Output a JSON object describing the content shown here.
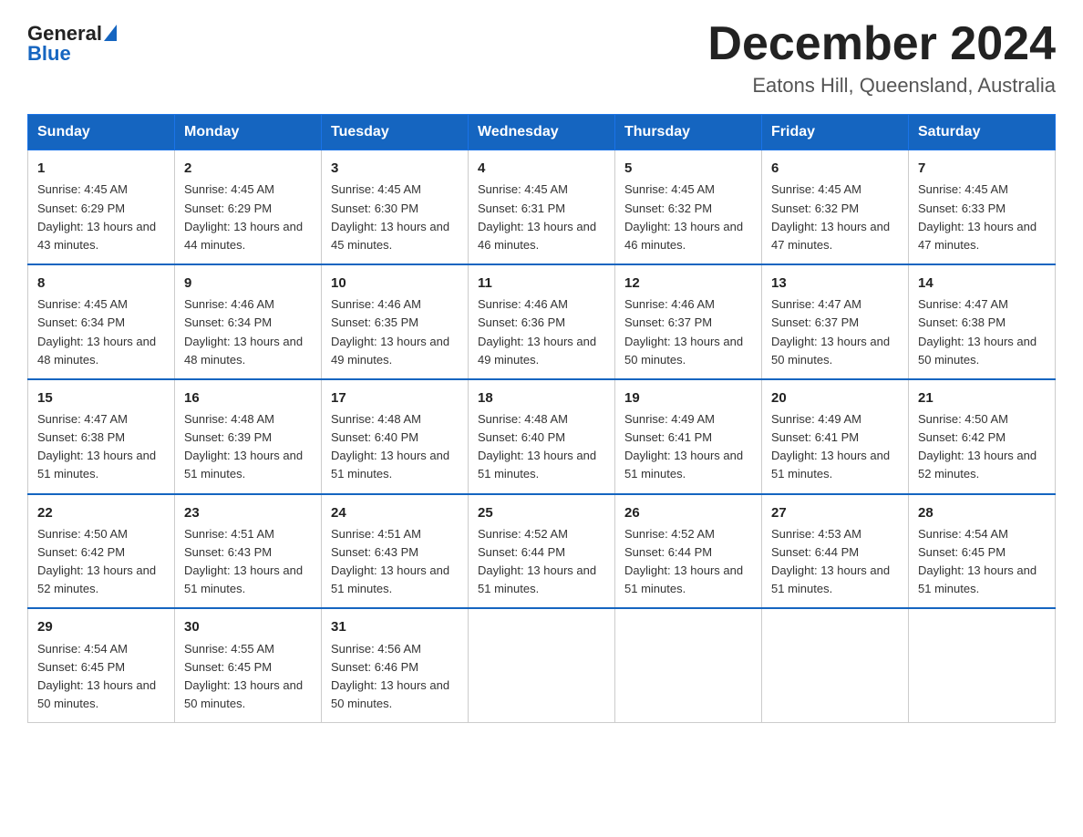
{
  "logo": {
    "general": "General",
    "blue": "Blue"
  },
  "header": {
    "title": "December 2024",
    "subtitle": "Eatons Hill, Queensland, Australia"
  },
  "weekdays": [
    "Sunday",
    "Monday",
    "Tuesday",
    "Wednesday",
    "Thursday",
    "Friday",
    "Saturday"
  ],
  "weeks": [
    [
      {
        "day": "1",
        "sunrise": "4:45 AM",
        "sunset": "6:29 PM",
        "daylight": "13 hours and 43 minutes."
      },
      {
        "day": "2",
        "sunrise": "4:45 AM",
        "sunset": "6:29 PM",
        "daylight": "13 hours and 44 minutes."
      },
      {
        "day": "3",
        "sunrise": "4:45 AM",
        "sunset": "6:30 PM",
        "daylight": "13 hours and 45 minutes."
      },
      {
        "day": "4",
        "sunrise": "4:45 AM",
        "sunset": "6:31 PM",
        "daylight": "13 hours and 46 minutes."
      },
      {
        "day": "5",
        "sunrise": "4:45 AM",
        "sunset": "6:32 PM",
        "daylight": "13 hours and 46 minutes."
      },
      {
        "day": "6",
        "sunrise": "4:45 AM",
        "sunset": "6:32 PM",
        "daylight": "13 hours and 47 minutes."
      },
      {
        "day": "7",
        "sunrise": "4:45 AM",
        "sunset": "6:33 PM",
        "daylight": "13 hours and 47 minutes."
      }
    ],
    [
      {
        "day": "8",
        "sunrise": "4:45 AM",
        "sunset": "6:34 PM",
        "daylight": "13 hours and 48 minutes."
      },
      {
        "day": "9",
        "sunrise": "4:46 AM",
        "sunset": "6:34 PM",
        "daylight": "13 hours and 48 minutes."
      },
      {
        "day": "10",
        "sunrise": "4:46 AM",
        "sunset": "6:35 PM",
        "daylight": "13 hours and 49 minutes."
      },
      {
        "day": "11",
        "sunrise": "4:46 AM",
        "sunset": "6:36 PM",
        "daylight": "13 hours and 49 minutes."
      },
      {
        "day": "12",
        "sunrise": "4:46 AM",
        "sunset": "6:37 PM",
        "daylight": "13 hours and 50 minutes."
      },
      {
        "day": "13",
        "sunrise": "4:47 AM",
        "sunset": "6:37 PM",
        "daylight": "13 hours and 50 minutes."
      },
      {
        "day": "14",
        "sunrise": "4:47 AM",
        "sunset": "6:38 PM",
        "daylight": "13 hours and 50 minutes."
      }
    ],
    [
      {
        "day": "15",
        "sunrise": "4:47 AM",
        "sunset": "6:38 PM",
        "daylight": "13 hours and 51 minutes."
      },
      {
        "day": "16",
        "sunrise": "4:48 AM",
        "sunset": "6:39 PM",
        "daylight": "13 hours and 51 minutes."
      },
      {
        "day": "17",
        "sunrise": "4:48 AM",
        "sunset": "6:40 PM",
        "daylight": "13 hours and 51 minutes."
      },
      {
        "day": "18",
        "sunrise": "4:48 AM",
        "sunset": "6:40 PM",
        "daylight": "13 hours and 51 minutes."
      },
      {
        "day": "19",
        "sunrise": "4:49 AM",
        "sunset": "6:41 PM",
        "daylight": "13 hours and 51 minutes."
      },
      {
        "day": "20",
        "sunrise": "4:49 AM",
        "sunset": "6:41 PM",
        "daylight": "13 hours and 51 minutes."
      },
      {
        "day": "21",
        "sunrise": "4:50 AM",
        "sunset": "6:42 PM",
        "daylight": "13 hours and 52 minutes."
      }
    ],
    [
      {
        "day": "22",
        "sunrise": "4:50 AM",
        "sunset": "6:42 PM",
        "daylight": "13 hours and 52 minutes."
      },
      {
        "day": "23",
        "sunrise": "4:51 AM",
        "sunset": "6:43 PM",
        "daylight": "13 hours and 51 minutes."
      },
      {
        "day": "24",
        "sunrise": "4:51 AM",
        "sunset": "6:43 PM",
        "daylight": "13 hours and 51 minutes."
      },
      {
        "day": "25",
        "sunrise": "4:52 AM",
        "sunset": "6:44 PM",
        "daylight": "13 hours and 51 minutes."
      },
      {
        "day": "26",
        "sunrise": "4:52 AM",
        "sunset": "6:44 PM",
        "daylight": "13 hours and 51 minutes."
      },
      {
        "day": "27",
        "sunrise": "4:53 AM",
        "sunset": "6:44 PM",
        "daylight": "13 hours and 51 minutes."
      },
      {
        "day": "28",
        "sunrise": "4:54 AM",
        "sunset": "6:45 PM",
        "daylight": "13 hours and 51 minutes."
      }
    ],
    [
      {
        "day": "29",
        "sunrise": "4:54 AM",
        "sunset": "6:45 PM",
        "daylight": "13 hours and 50 minutes."
      },
      {
        "day": "30",
        "sunrise": "4:55 AM",
        "sunset": "6:45 PM",
        "daylight": "13 hours and 50 minutes."
      },
      {
        "day": "31",
        "sunrise": "4:56 AM",
        "sunset": "6:46 PM",
        "daylight": "13 hours and 50 minutes."
      },
      null,
      null,
      null,
      null
    ]
  ]
}
